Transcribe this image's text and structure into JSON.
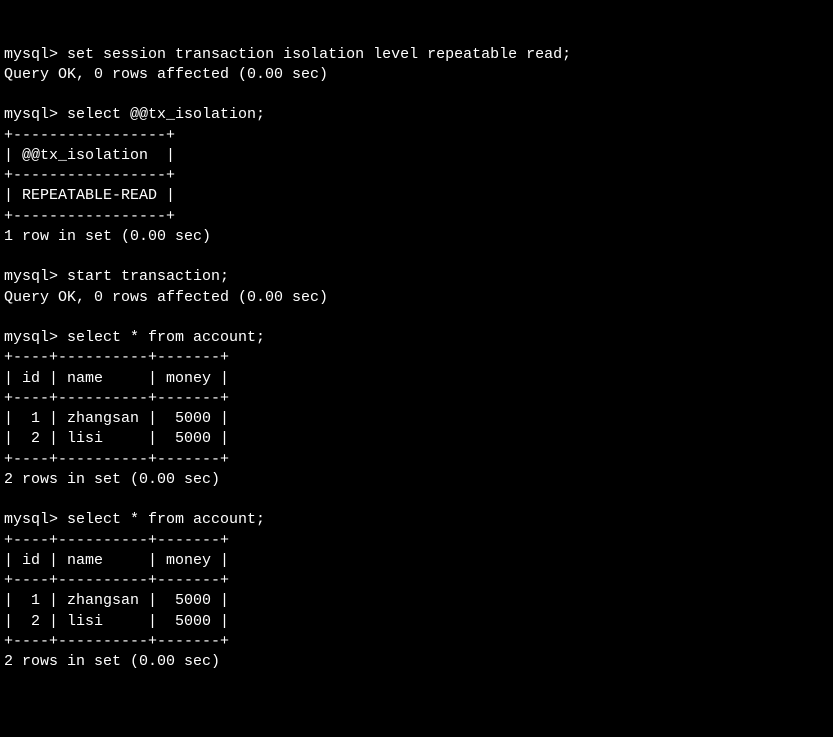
{
  "prompt": "mysql>",
  "commands": {
    "c1": "set session transaction isolation level repeatable read;",
    "c2": "select @@tx_isolation;",
    "c3": "start transaction;",
    "c4": "select * from account;",
    "c5": "select * from account;"
  },
  "responses": {
    "query_ok": "Query OK, 0 rows affected (0.00 sec)",
    "one_row": "1 row in set (0.00 sec)",
    "two_rows": "2 rows in set (0.00 sec)"
  },
  "iso_table": {
    "border_top": "+-----------------+",
    "header": "| @@tx_isolation  |",
    "border_mid": "+-----------------+",
    "row": "| REPEATABLE-READ |",
    "border_bot": "+-----------------+"
  },
  "account_table": {
    "border": "+----+----------+-------+",
    "header": "| id | name     | money |",
    "rows": [
      {
        "line": "|  1 | zhangsan |  5000 |",
        "id": 1,
        "name": "zhangsan",
        "money": 5000
      },
      {
        "line": "|  2 | lisi     |  5000 |",
        "id": 2,
        "name": "lisi",
        "money": 5000
      }
    ]
  },
  "chart_data": {
    "type": "table",
    "title": "account",
    "columns": [
      "id",
      "name",
      "money"
    ],
    "rows": [
      [
        1,
        "zhangsan",
        5000
      ],
      [
        2,
        "lisi",
        5000
      ]
    ]
  }
}
